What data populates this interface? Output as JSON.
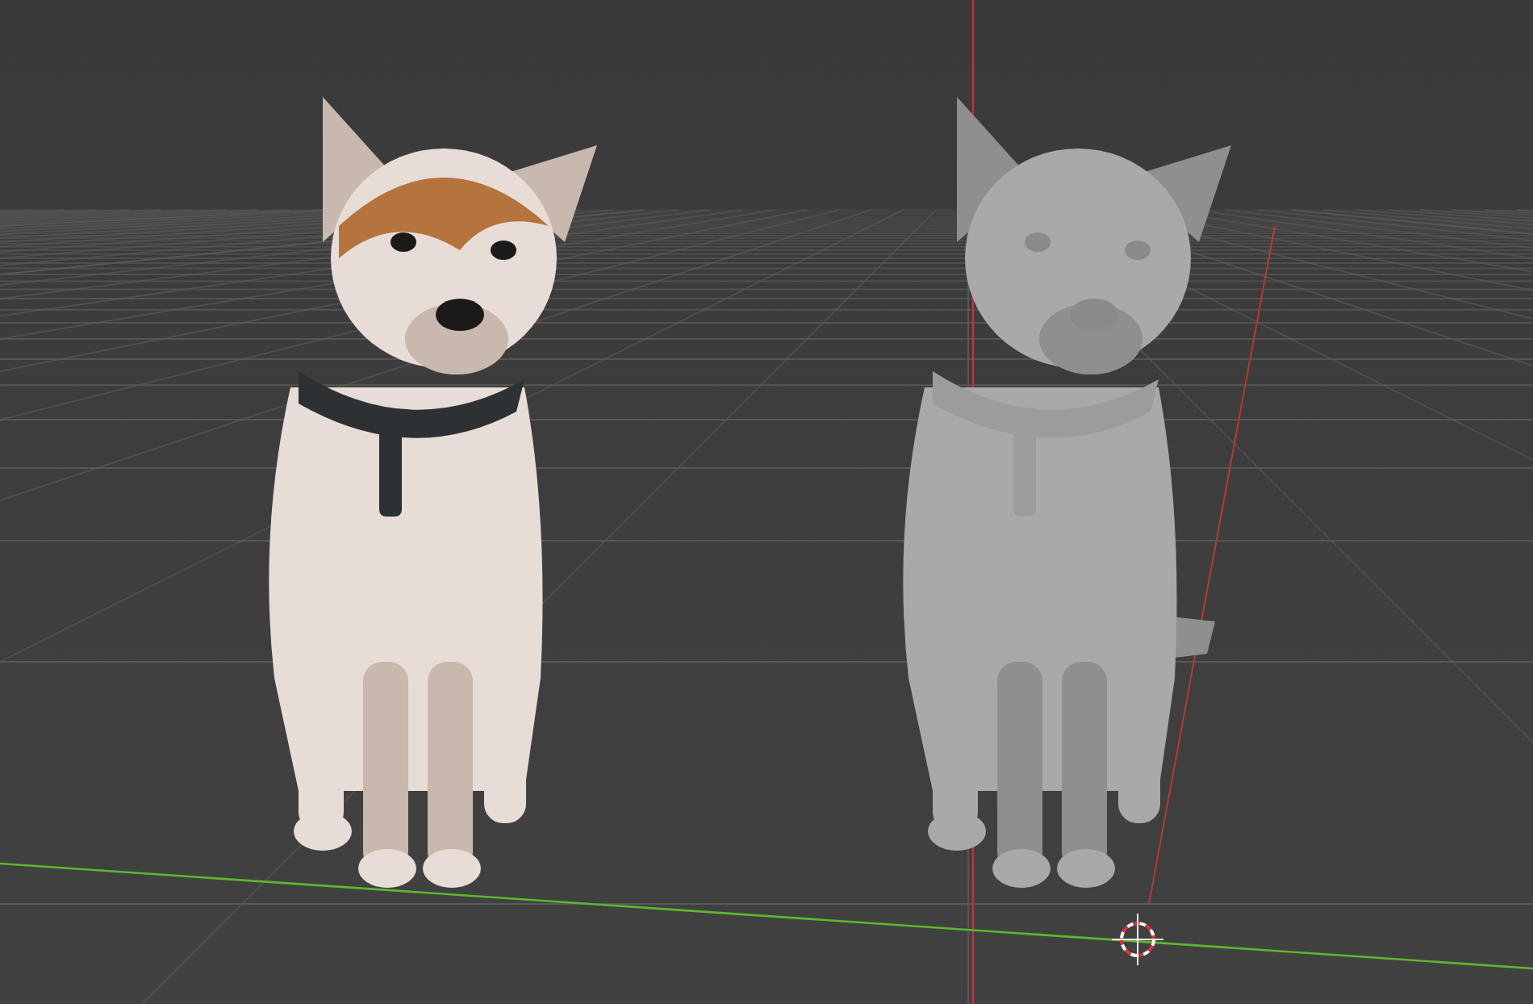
{
  "viewport": {
    "objects": [
      {
        "textured": true
      },
      {
        "textured": false
      }
    ]
  }
}
